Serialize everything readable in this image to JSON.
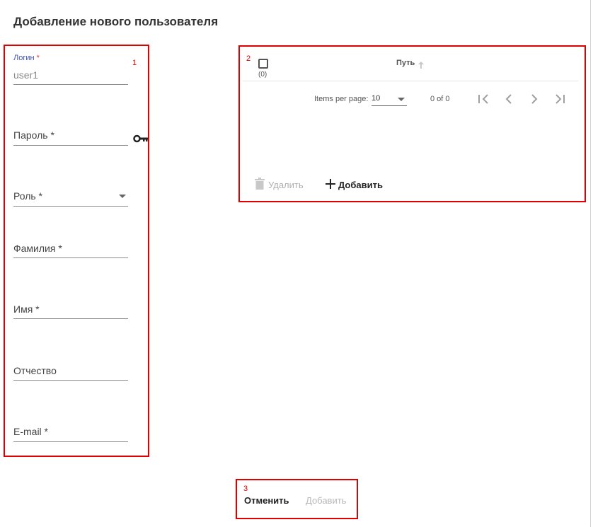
{
  "page": {
    "title": "Добавление нового пользователя"
  },
  "annotations": {
    "box1": "1",
    "box2": "2",
    "box3": "3"
  },
  "form": {
    "login": {
      "label": "Логин",
      "required_mark": "*",
      "value": "user1"
    },
    "password": {
      "label": "Пароль *",
      "icon": "key-icon"
    },
    "role": {
      "label": "Роль *"
    },
    "last_name": {
      "label": "Фамилия *"
    },
    "first_name": {
      "label": "Имя *"
    },
    "middle_name": {
      "label": "Отчество"
    },
    "email": {
      "label": "E-mail *"
    }
  },
  "table": {
    "selected_count": "(0)",
    "columns": [
      "Путь"
    ],
    "sort": "ascending",
    "paginator": {
      "items_per_page_label": "Items per page:",
      "items_per_page": "10",
      "range": "0 of 0"
    },
    "actions": {
      "delete_label": "Удалить",
      "add_label": "Добавить"
    }
  },
  "footer": {
    "cancel_label": "Отменить",
    "submit_label": "Добавить"
  },
  "colors": {
    "annotation_border": "#e00000",
    "accent": "#3f51b5",
    "required": "#e53935"
  }
}
